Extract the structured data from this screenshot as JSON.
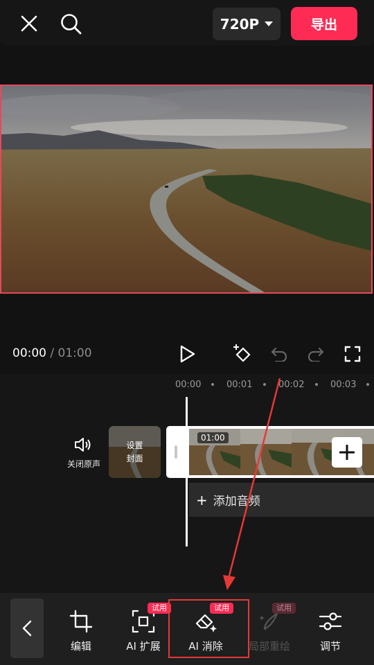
{
  "header": {
    "resolution": "720P",
    "export_label": "导出"
  },
  "player": {
    "current_time": "00:00",
    "separator": "/",
    "total_time": "01:00"
  },
  "ruler": {
    "labels": [
      "00:00",
      "00:01",
      "00:02",
      "00:03"
    ]
  },
  "timeline": {
    "mute_label": "关闭原声",
    "cover_line1": "设置",
    "cover_line2": "封面",
    "clip_duration": "01:00",
    "add_audio_label": "添加音频"
  },
  "toolbar": {
    "items": [
      {
        "label": "编辑",
        "trial": ""
      },
      {
        "label": "AI 扩展",
        "trial": "试用"
      },
      {
        "label": "AI 消除",
        "trial": "试用"
      },
      {
        "label": "局部重绘",
        "trial": "试用"
      },
      {
        "label": "调节",
        "trial": ""
      }
    ]
  },
  "colors": {
    "accent": "#fe2c55",
    "highlight": "#e53935",
    "background": "#121212"
  }
}
